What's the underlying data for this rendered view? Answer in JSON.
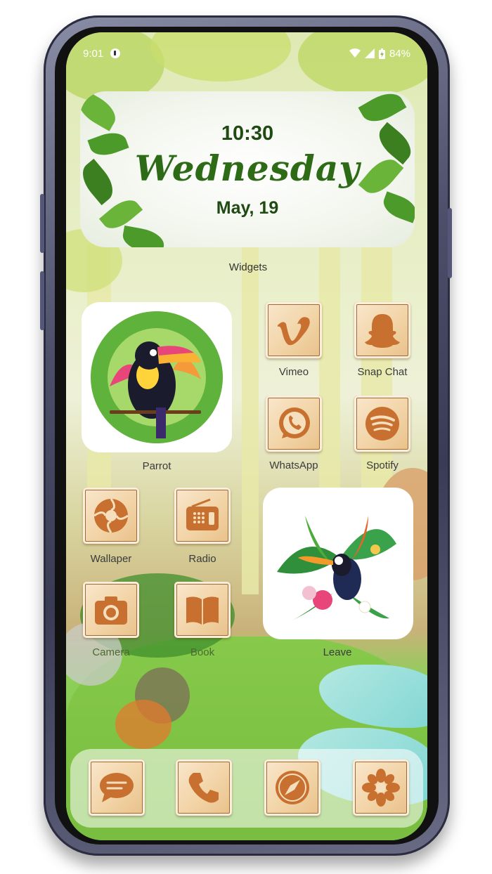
{
  "status_bar": {
    "time": "9:01",
    "battery": "84%"
  },
  "clock_widget": {
    "time": "10:30",
    "day": "Wednesday",
    "date": "May, 19"
  },
  "section_label": "Widgets",
  "apps": {
    "parrot": "Parrot",
    "vimeo": "Vimeo",
    "snapchat": "Snap Chat",
    "whatsapp": "WhatsApp",
    "spotify": "Spotify",
    "wallpaper": "Wallaper",
    "radio": "Radio",
    "camera": "Camera",
    "book": "Book",
    "leave": "Leave"
  },
  "dock": [
    "message-icon",
    "phone-icon",
    "compass-icon",
    "flower-icon"
  ],
  "colors": {
    "wood": "#d98a3d",
    "wood_dark": "#a85a1f",
    "clock_green": "#2d6b16",
    "frame": "#4d4f6a"
  }
}
